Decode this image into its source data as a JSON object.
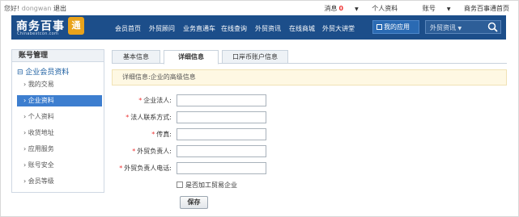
{
  "topbar": {
    "greeting": "您好!",
    "username": "dongwan",
    "logout": "退出",
    "messages_label": "消息",
    "messages_count": "0",
    "personal": "个人资料",
    "account": "账号",
    "home": "商务百事通首页"
  },
  "logo": {
    "cn": "商务百事",
    "en": "Chinabestcon.com",
    "badge": "通"
  },
  "nav": {
    "items": [
      "会员首页",
      "外贸顾问",
      "业务直通车",
      "在线查询",
      "外贸资讯",
      "在线商城",
      "外贸大讲堂"
    ],
    "myapp": "我的应用",
    "search_scope": "外贸资讯"
  },
  "sidebar": {
    "title": "账号管理",
    "group": "企业会员资料",
    "items": [
      "我的交易",
      "企业资料",
      "个人资料",
      "收货地址",
      "应用服务",
      "账号安全",
      "会员等级"
    ],
    "active_index": 1
  },
  "tabs": [
    "基本信息",
    "详细信息",
    "口岸币账户信息"
  ],
  "notice": "详细信息:企业的高级信息",
  "form": {
    "fields": [
      {
        "label": "企业法人:",
        "required": true,
        "value": ""
      },
      {
        "label": "法人联系方式:",
        "required": true,
        "value": ""
      },
      {
        "label": "传真:",
        "required": true,
        "value": ""
      },
      {
        "label": "外贸负责人:",
        "required": true,
        "value": ""
      },
      {
        "label": "外贸负责人电话:",
        "required": true,
        "value": ""
      }
    ],
    "checkbox_label": "是否加工贸易企业",
    "save": "保存"
  },
  "colors": {
    "nav_bg": "#1c4e8a",
    "active_item": "#3d7ecf",
    "required": "#e33333",
    "notice_bg": "#fef8e3"
  }
}
